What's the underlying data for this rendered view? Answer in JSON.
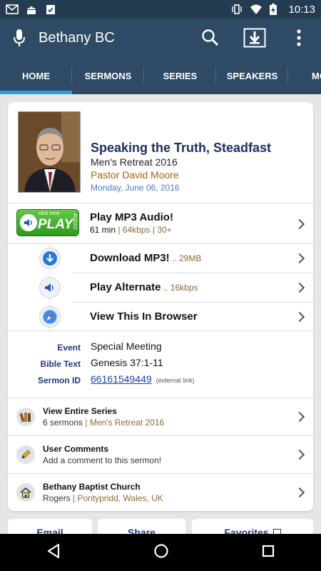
{
  "status_bar": {
    "time": "10:13",
    "left_icons": [
      "mail-icon",
      "android-icon",
      "clipboard-check-icon"
    ],
    "right_icons": [
      "vibrate-icon",
      "wifi-icon",
      "battery-charging-icon"
    ]
  },
  "app_bar": {
    "title": "Bethany BC",
    "icons": [
      "mic-icon",
      "search-icon",
      "download-icon",
      "overflow-menu-icon"
    ]
  },
  "tabs": [
    {
      "label": "HOME",
      "active": true
    },
    {
      "label": "SERMONS"
    },
    {
      "label": "SERIES"
    },
    {
      "label": "SPEAKERS"
    },
    {
      "label": "MO"
    }
  ],
  "sermon": {
    "title": "Speaking the Truth, Steadfast",
    "subtitle": "Men's Retreat 2016",
    "speaker": "Pastor David Moore",
    "date": "Monday, June 06, 2016"
  },
  "play_badge": {
    "click_here": "click here",
    "play": "PLAY",
    "audio": "AUDIO"
  },
  "actions": {
    "play_mp3": {
      "title": "Play MP3 Audio!",
      "duration": "61 min",
      "meta": "| 64kbps | 30+"
    },
    "download_mp3": {
      "title": "Download MP3!",
      "meta": " .. 29MB"
    },
    "play_alternate": {
      "title": "Play Alternate",
      "meta": " .. 16kbps"
    },
    "view_browser": {
      "title": "View This In Browser"
    }
  },
  "details": {
    "event_label": "Event",
    "event_value": "Special Meeting",
    "bible_label": "Bible Text",
    "bible_value": "Genesis 37:1-11",
    "id_label": "Sermon ID",
    "id_value": "66161549449",
    "id_note": "(external link)"
  },
  "list": {
    "series": {
      "title": "View Entire Series",
      "sub": "6 sermons",
      "meta": "| Men's Retreat 2016"
    },
    "comments": {
      "title": "User Comments",
      "sub": "Add a comment to this sermon!"
    },
    "church": {
      "title": "Bethany Baptist Church",
      "sub": "Rogers",
      "meta": "| Pontypridd, Wales, UK"
    }
  },
  "bottom_buttons": {
    "email": "Email",
    "share": "Share",
    "favorites": "Favorites"
  },
  "colors": {
    "appbar": "#2e4a64",
    "statusbar": "#243c52",
    "tab_indicator": "#2c9de0",
    "title": "#1f2f5e",
    "speaker": "#a8620e",
    "date": "#4a7ac8",
    "play_green": "#3fae2a"
  }
}
